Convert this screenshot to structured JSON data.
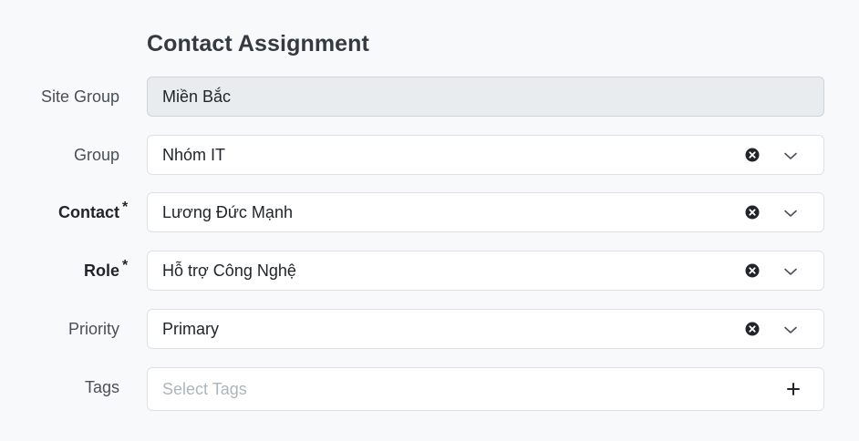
{
  "form": {
    "title": "Contact Assignment",
    "fields": {
      "site_group": {
        "label": "Site Group",
        "value": "Miền Bắc"
      },
      "group": {
        "label": "Group",
        "value": "Nhóm IT"
      },
      "contact": {
        "label": "Contact",
        "required_mark": "*",
        "value": "Lương Đức Mạnh"
      },
      "role": {
        "label": "Role",
        "required_mark": "*",
        "value": "Hỗ trợ Công Nghệ"
      },
      "priority": {
        "label": "Priority",
        "value": "Primary"
      },
      "tags": {
        "label": "Tags",
        "placeholder": "Select Tags"
      }
    }
  },
  "icons": {
    "clear": "clear-circle-x-icon",
    "dropdown": "chevron-down-icon",
    "add": "plus-icon"
  }
}
